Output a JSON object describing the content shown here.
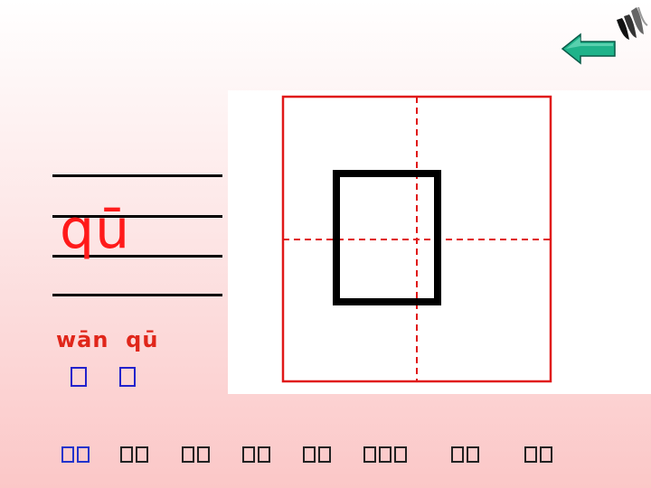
{
  "lesson": {
    "pinyin_big": "qū",
    "word_pinyin": "wān  qū"
  },
  "colors": {
    "pinyin": "#ff1a1a",
    "grid_red": "#e01818",
    "nav_active": "#2233cc",
    "nav_default": "#222222"
  },
  "icons": {
    "logo": "swoosh-logo-icon",
    "back": "left-arrow-icon"
  },
  "bottom_nav": [
    {
      "glyph_count": 2,
      "active": true
    },
    {
      "glyph_count": 2,
      "active": false
    },
    {
      "glyph_count": 2,
      "active": false
    },
    {
      "glyph_count": 2,
      "active": false
    },
    {
      "glyph_count": 2,
      "active": false
    },
    {
      "glyph_count": 3,
      "active": false
    },
    {
      "glyph_count": 2,
      "active": false
    },
    {
      "glyph_count": 2,
      "active": false
    }
  ]
}
